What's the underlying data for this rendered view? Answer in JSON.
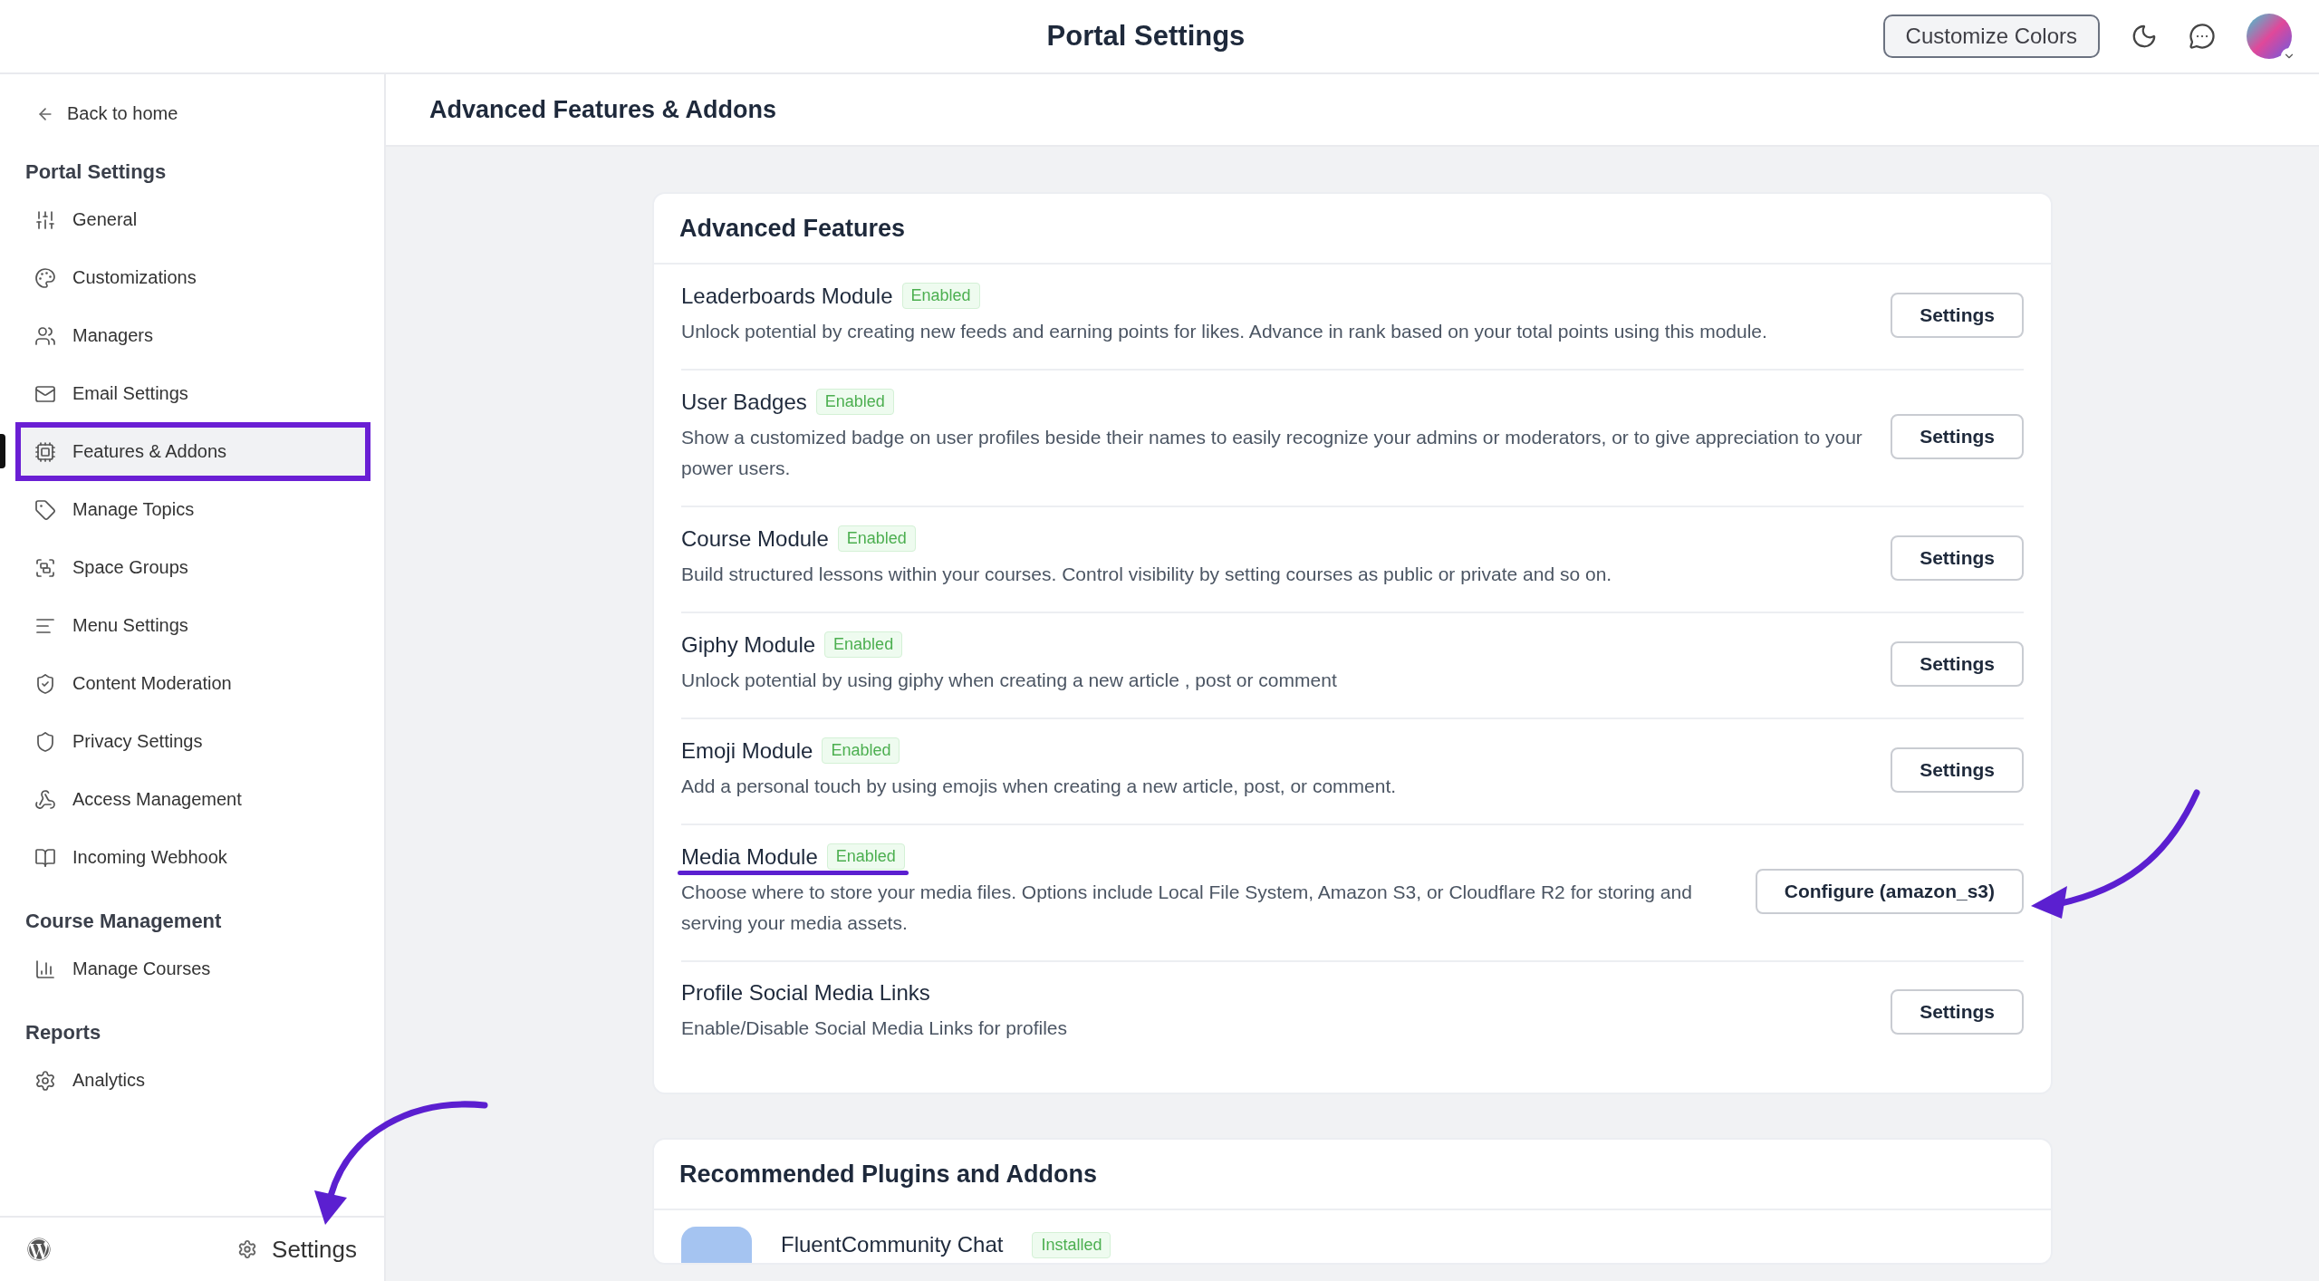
{
  "topbar": {
    "title": "Portal Settings",
    "customize_button": "Customize Colors"
  },
  "sidebar": {
    "back_link": "Back to home",
    "sections": [
      {
        "heading": "Portal Settings",
        "items": [
          {
            "label": "General",
            "selected": false
          },
          {
            "label": "Customizations",
            "selected": false
          },
          {
            "label": "Managers",
            "selected": false
          },
          {
            "label": "Email Settings",
            "selected": false
          },
          {
            "label": "Features & Addons",
            "selected": true
          },
          {
            "label": "Manage Topics",
            "selected": false
          },
          {
            "label": "Space Groups",
            "selected": false
          },
          {
            "label": "Menu Settings",
            "selected": false
          },
          {
            "label": "Content Moderation",
            "selected": false
          },
          {
            "label": "Privacy Settings",
            "selected": false
          },
          {
            "label": "Access Management",
            "selected": false
          },
          {
            "label": "Incoming Webhook",
            "selected": false
          }
        ]
      },
      {
        "heading": "Course Management",
        "items": [
          {
            "label": "Manage Courses",
            "selected": false
          }
        ]
      },
      {
        "heading": "Reports",
        "items": [
          {
            "label": "Analytics",
            "selected": false
          }
        ]
      }
    ],
    "footer_settings": "Settings"
  },
  "page_header": {
    "title": "Advanced Features & Addons"
  },
  "features_card": {
    "title": "Advanced Features",
    "modules": [
      {
        "name": "Leaderboards Module",
        "status": "Enabled",
        "description": "Unlock potential by creating new feeds and earning points for likes. Advance in rank based on your total points using this module.",
        "button": "Settings"
      },
      {
        "name": "User Badges",
        "status": "Enabled",
        "description": "Show a customized badge on user profiles beside their names to easily recognize your admins or moderators, or to give appreciation to your power users.",
        "button": "Settings"
      },
      {
        "name": "Course Module",
        "status": "Enabled",
        "description": "Build structured lessons within your courses. Control visibility by setting courses as public or private and so on.",
        "button": "Settings"
      },
      {
        "name": "Giphy Module",
        "status": "Enabled",
        "description": "Unlock potential by using giphy when creating a new article , post or comment",
        "button": "Settings"
      },
      {
        "name": "Emoji Module",
        "status": "Enabled",
        "description": "Add a personal touch by using emojis when creating a new article, post, or comment.",
        "button": "Settings"
      },
      {
        "name": "Media Module",
        "status": "Enabled",
        "description": "Choose where to store your media files. Options include Local File System, Amazon S3, or Cloudflare R2 for storing and serving your media assets.",
        "button": "Configure (amazon_s3)",
        "underlined": true
      },
      {
        "name": "Profile Social Media Links",
        "description": "Enable/Disable Social Media Links for profiles",
        "button": "Settings"
      }
    ]
  },
  "recommended_card": {
    "title": "Recommended Plugins and Addons",
    "plugins": [
      {
        "name": "FluentCommunity Chat",
        "status": "Installed"
      }
    ]
  }
}
